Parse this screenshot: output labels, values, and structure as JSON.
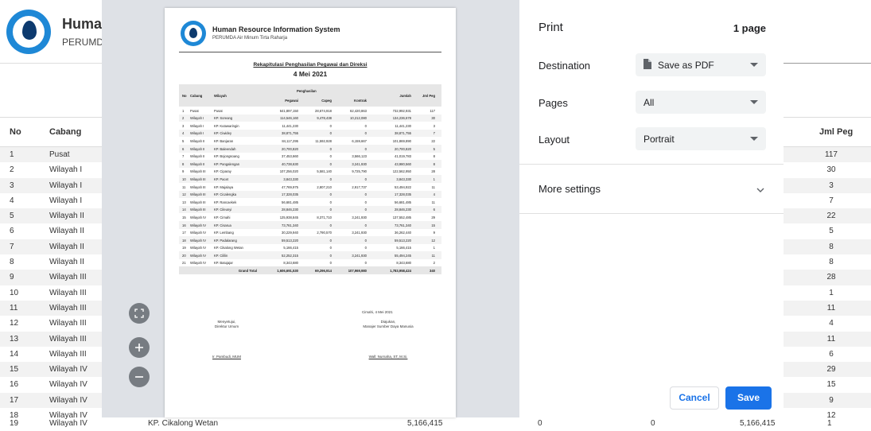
{
  "background": {
    "app_title": "Human",
    "app_subtitle": "PERUMDA",
    "columns": {
      "no": "No",
      "cabang": "Cabang",
      "jml_peg": "Jml Peg"
    },
    "rows": [
      {
        "no": "1",
        "cabang": "Pusat",
        "jml": "117"
      },
      {
        "no": "2",
        "cabang": "Wilayah I",
        "jml": "30"
      },
      {
        "no": "3",
        "cabang": "Wilayah I",
        "jml": "3"
      },
      {
        "no": "4",
        "cabang": "Wilayah I",
        "jml": "7"
      },
      {
        "no": "5",
        "cabang": "Wilayah II",
        "jml": "22"
      },
      {
        "no": "6",
        "cabang": "Wilayah II",
        "jml": "5"
      },
      {
        "no": "7",
        "cabang": "Wilayah II",
        "jml": "8"
      },
      {
        "no": "8",
        "cabang": "Wilayah II",
        "jml": "8"
      },
      {
        "no": "9",
        "cabang": "Wilayah III",
        "jml": "28"
      },
      {
        "no": "10",
        "cabang": "Wilayah III",
        "jml": "1"
      },
      {
        "no": "11",
        "cabang": "Wilayah III",
        "jml": "11"
      },
      {
        "no": "12",
        "cabang": "Wilayah III",
        "jml": "4"
      },
      {
        "no": "13",
        "cabang": "Wilayah III",
        "jml": "11"
      },
      {
        "no": "14",
        "cabang": "Wilayah III",
        "jml": "6"
      },
      {
        "no": "15",
        "cabang": "Wilayah IV",
        "jml": "29"
      },
      {
        "no": "16",
        "cabang": "Wilayah IV",
        "jml": "15"
      },
      {
        "no": "17",
        "cabang": "Wilayah IV",
        "jml": "9"
      },
      {
        "no": "18",
        "cabang": "Wilayah IV",
        "jml": "12"
      }
    ],
    "bottom_row": {
      "no": "19",
      "cabang": "Wilayah IV",
      "wilayah": "KP. Cikalong Wetan",
      "pegawai": "5,166,415",
      "capeg": "0",
      "kontrak": "0",
      "jumlah": "5,166,415",
      "jml": "1"
    }
  },
  "print_dialog": {
    "title": "Print",
    "page_count": "1 page",
    "destination_label": "Destination",
    "destination_value": "Save as PDF",
    "pages_label": "Pages",
    "pages_value": "All",
    "layout_label": "Layout",
    "layout_value": "Portrait",
    "more_settings": "More settings",
    "cancel": "Cancel",
    "save": "Save"
  },
  "preview": {
    "title": "Human Resource Information System",
    "subtitle": "PERUMDA Air Minum Tirta Raharja",
    "report_title": "Rekapitulasi Penghasilan Pegawai dan Direksi",
    "report_date": "4 Mei 2021",
    "headers": {
      "no": "No",
      "cabang": "Cabang",
      "wilayah": "Wilayah",
      "penghasilan": "Penghasilan",
      "pegawai": "Pegawai",
      "capeg": "Capeg",
      "kontrak": "Kontrak",
      "jumlah": "Jumlah",
      "jml_peg": "Jml Peg"
    },
    "rows": [
      [
        "1",
        "Pusat",
        "Pusat",
        "641,897,150",
        "28,674,918",
        "62,420,863",
        "732,992,931",
        "117"
      ],
      [
        "2",
        "Wilayah I",
        "KP. Soreang",
        "114,546,160",
        "9,478,438",
        "10,212,080",
        "134,236,678",
        "30"
      ],
      [
        "3",
        "Wilayah I",
        "KP. Kutawaringin",
        "11,441,230",
        "0",
        "0",
        "11,441,230",
        "3"
      ],
      [
        "4",
        "Wilayah I",
        "KP. Ciwidey",
        "38,871,755",
        "0",
        "0",
        "38,871,755",
        "7"
      ],
      [
        "5",
        "Wilayah II",
        "KP. Banjaran",
        "84,117,295",
        "11,592,928",
        "6,159,667",
        "101,869,890",
        "22"
      ],
      [
        "6",
        "Wilayah II",
        "KP. Baleendah",
        "20,700,820",
        "0",
        "0",
        "20,700,820",
        "5"
      ],
      [
        "7",
        "Wilayah II",
        "KP. Bojongsoang",
        "37,453,660",
        "0",
        "3,566,123",
        "41,019,783",
        "8"
      ],
      [
        "8",
        "Wilayah II",
        "KP. Pangalengan",
        "40,738,630",
        "0",
        "3,241,930",
        "43,980,560",
        "8"
      ],
      [
        "9",
        "Wilayah III",
        "KP. Ciparay",
        "107,256,020",
        "5,581,140",
        "9,725,790",
        "122,562,950",
        "28"
      ],
      [
        "10",
        "Wilayah III",
        "KP. Pacet",
        "3,843,330",
        "0",
        "0",
        "3,843,330",
        "1"
      ],
      [
        "11",
        "Wilayah III",
        "KP. Majalaya",
        "47,769,975",
        "2,807,210",
        "2,917,737",
        "53,494,922",
        "11"
      ],
      [
        "12",
        "Wilayah III",
        "KP. Cicalengka",
        "17,328,035",
        "0",
        "0",
        "17,328,035",
        "4"
      ],
      [
        "13",
        "Wilayah III",
        "KP. Rancaekek",
        "56,681,485",
        "0",
        "0",
        "56,681,485",
        "11"
      ],
      [
        "14",
        "Wilayah III",
        "KP. Cileunyi",
        "28,846,230",
        "0",
        "0",
        "28,846,230",
        "6"
      ],
      [
        "15",
        "Wilayah IV",
        "KP. Cimahi",
        "125,938,845",
        "8,371,710",
        "3,241,930",
        "137,552,485",
        "29"
      ],
      [
        "16",
        "Wilayah IV",
        "KP. Cisarua",
        "73,761,340",
        "0",
        "0",
        "73,761,340",
        "15"
      ],
      [
        "17",
        "Wilayah IV",
        "KP. Lembang",
        "30,229,940",
        "2,790,570",
        "3,241,930",
        "36,262,440",
        "9"
      ],
      [
        "18",
        "Wilayah IV",
        "KP. Padalarang",
        "59,513,220",
        "0",
        "0",
        "59,513,220",
        "12"
      ],
      [
        "19",
        "Wilayah IV",
        "KP. Cikalong Wetan",
        "5,166,415",
        "0",
        "0",
        "5,166,415",
        "1"
      ],
      [
        "20",
        "Wilayah IV",
        "KP. Cililin",
        "52,252,315",
        "0",
        "3,241,930",
        "55,494,245",
        "11"
      ],
      [
        "21",
        "Wilayah IV",
        "KP. Batujajar",
        "8,343,680",
        "0",
        "0",
        "8,343,680",
        "2"
      ]
    ],
    "total": {
      "label": "Grand Total",
      "pegawai": "1,606,691,530",
      "capeg": "69,296,914",
      "kontrak": "107,969,980",
      "jumlah": "1,783,958,424",
      "jml": "340"
    },
    "place_date": "Cimahi, 4 Mei 2021",
    "left_sign_1": "Menyetujui,",
    "left_sign_2": "Direktur Umum",
    "right_sign_1": "Diajukan,",
    "right_sign_2": "Manajer Sumber Daya Manusia",
    "left_name": "Ir. Pambudi, MUM",
    "right_name": "Wall: Nurnaha, ST, M.Si."
  },
  "icons": {
    "file": "file-icon",
    "chevron": "chevron-down-icon",
    "zoom_fit": "fit-to-page-icon",
    "zoom_in": "plus-icon",
    "zoom_out": "minus-icon"
  }
}
